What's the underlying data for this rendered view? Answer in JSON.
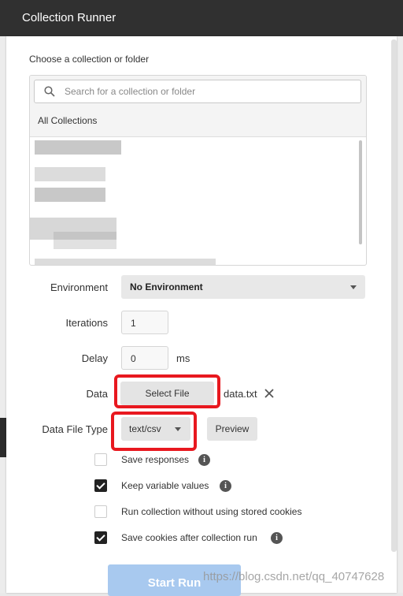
{
  "window": {
    "title": "Collection Runner"
  },
  "collection": {
    "label": "Choose a collection or folder",
    "search_placeholder": "Search for a collection or folder",
    "all_collections": "All Collections"
  },
  "environment": {
    "label": "Environment",
    "value": "No Environment"
  },
  "iterations": {
    "label": "Iterations",
    "value": "1"
  },
  "delay": {
    "label": "Delay",
    "value": "0",
    "unit": "ms"
  },
  "data": {
    "label": "Data",
    "button": "Select File",
    "filename": "data.txt",
    "clear_icon": "close-icon"
  },
  "data_file_type": {
    "label": "Data File Type",
    "value": "text/csv",
    "preview": "Preview"
  },
  "options": [
    {
      "label": "Save responses",
      "checked": false,
      "info": "i"
    },
    {
      "label": "Keep variable values",
      "checked": true,
      "info": "i"
    },
    {
      "label": "Run collection without using stored cookies",
      "checked": false
    },
    {
      "label": "Save cookies after collection run",
      "checked": true,
      "info": "i"
    }
  ],
  "start_button": "Start Run",
  "watermark": "https://blog.csdn.net/qq_40747628",
  "colors": {
    "highlight": "#e8181f",
    "start_button": "#a8c9ef",
    "titlebar": "#303030"
  }
}
